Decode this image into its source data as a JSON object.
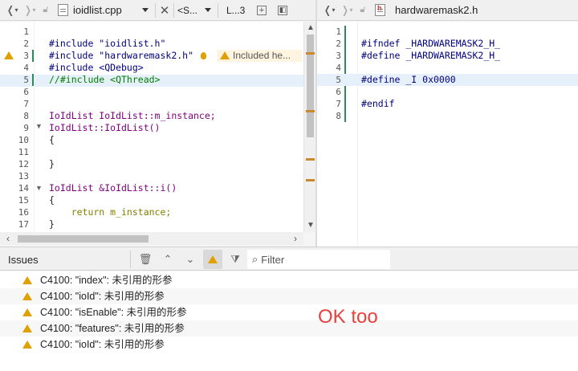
{
  "left_editor": {
    "file_name": "ioidlist.cpp",
    "symbol_selector": "<S...",
    "line_indicator": "L...3",
    "lines": [
      {
        "no": "1",
        "code": ""
      },
      {
        "no": "2",
        "code": "#include \"ioidlist.h\""
      },
      {
        "no": "3",
        "code": "#include \"hardwaremask2.h\""
      },
      {
        "no": "4",
        "code": "#include <QDebug>"
      },
      {
        "no": "5",
        "code": "//#include <QThread>"
      },
      {
        "no": "6",
        "code": ""
      },
      {
        "no": "7",
        "code": ""
      },
      {
        "no": "8",
        "code": "IoIdList IoIdList::m_instance;"
      },
      {
        "no": "9",
        "code": "IoIdList::IoIdList()"
      },
      {
        "no": "10",
        "code": "{"
      },
      {
        "no": "11",
        "code": ""
      },
      {
        "no": "12",
        "code": "}"
      },
      {
        "no": "13",
        "code": ""
      },
      {
        "no": "14",
        "code": "IoIdList &IoIdList::i()"
      },
      {
        "no": "15",
        "code": "{"
      },
      {
        "no": "16",
        "code": "    return m_instance;"
      },
      {
        "no": "17",
        "code": "}"
      }
    ],
    "inline_warning": "Included he..."
  },
  "right_editor": {
    "file_name": "hardwaremask2.h",
    "lines": [
      {
        "no": "1",
        "code": ""
      },
      {
        "no": "2",
        "code": "#ifndef _HARDWAREMASK2_H_"
      },
      {
        "no": "3",
        "code": "#define _HARDWAREMASK2_H_"
      },
      {
        "no": "4",
        "code": ""
      },
      {
        "no": "5",
        "code": "#define _I 0x0000"
      },
      {
        "no": "6",
        "code": ""
      },
      {
        "no": "7",
        "code": "#endif"
      },
      {
        "no": "8",
        "code": ""
      }
    ]
  },
  "issues": {
    "title": "Issues",
    "filter_placeholder": "Filter",
    "items": [
      "C4100: \"index\": 未引用的形参",
      "C4100: \"ioId\": 未引用的形参",
      "C4100: \"isEnable\": 未引用的形参",
      "C4100: \"features\": 未引用的形参",
      "C4100: \"ioId\": 未引用的形参"
    ]
  },
  "annotation": "OK too",
  "colors": {
    "warning": "#e0a000",
    "annotation": "#e8413b",
    "current_line": "#e6f0fa",
    "scroll_marker": "#c98a2b"
  }
}
